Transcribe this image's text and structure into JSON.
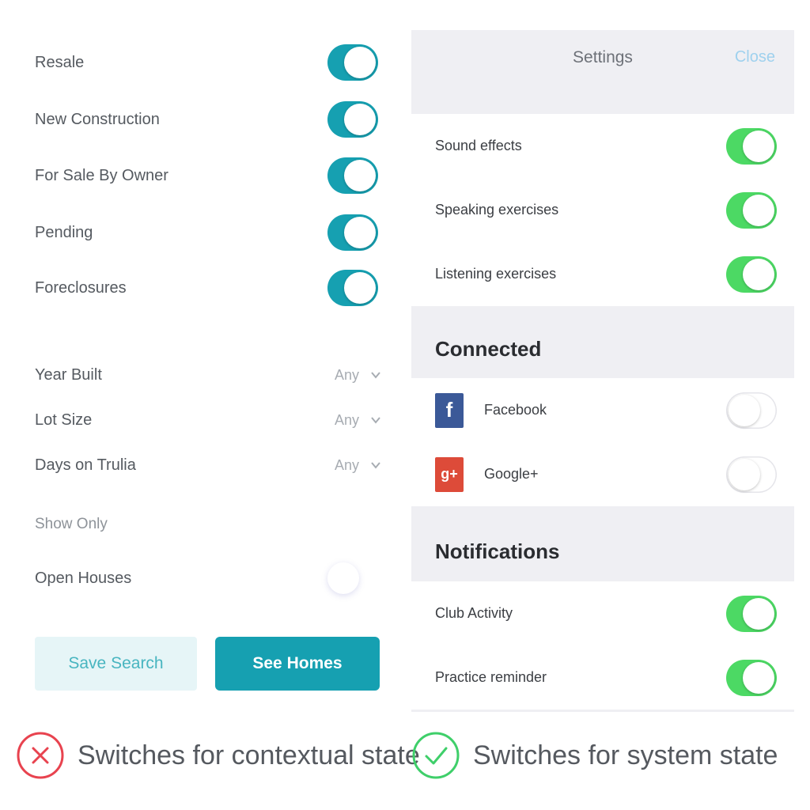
{
  "left": {
    "toggles": [
      {
        "label": "Resale",
        "on": true
      },
      {
        "label": "New Construction",
        "on": true
      },
      {
        "label": "For Sale By Owner",
        "on": true
      },
      {
        "label": "Pending",
        "on": true
      },
      {
        "label": "Foreclosures",
        "on": true
      }
    ],
    "selects": [
      {
        "label": "Year Built",
        "value": "Any"
      },
      {
        "label": "Lot Size",
        "value": "Any"
      },
      {
        "label": "Days on Trulia",
        "value": "Any"
      }
    ],
    "show_only": "Show Only",
    "open_houses": {
      "label": "Open Houses",
      "on": false
    },
    "save_button": "Save Search",
    "see_button": "See Homes",
    "accent": "#16a0b1"
  },
  "right": {
    "title": "Settings",
    "close": "Close",
    "general": [
      {
        "label": "Sound effects",
        "on": true
      },
      {
        "label": "Speaking exercises",
        "on": true
      },
      {
        "label": "Listening exercises",
        "on": true
      }
    ],
    "connected_header": "Connected",
    "connected": [
      {
        "label": "Facebook",
        "icon": "facebook-icon",
        "on": false
      },
      {
        "label": "Google+",
        "icon": "google-plus-icon",
        "on": false
      }
    ],
    "notifications_header": "Notifications",
    "notifications": [
      {
        "label": "Club Activity",
        "on": true
      },
      {
        "label": "Practice reminder",
        "on": true
      }
    ],
    "accent": "#4cd964"
  },
  "captions": {
    "bad": "Switches for contextual state",
    "good": "Switches for system state",
    "bad_color": "#e8434f",
    "good_color": "#3fcf6a"
  }
}
